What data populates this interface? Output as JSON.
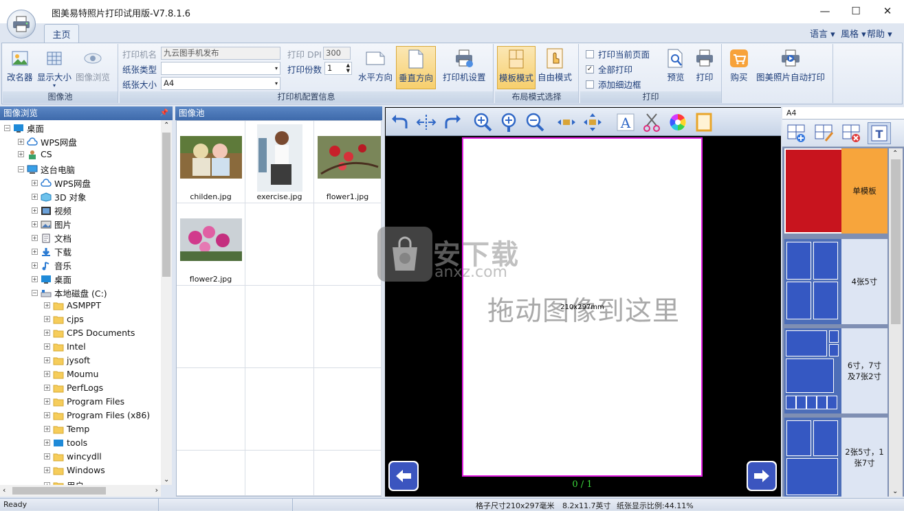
{
  "app": {
    "title": "图美易特照片打印试用版-V7.8.1.6",
    "tab_main": "主页"
  },
  "menu": {
    "language": "语言",
    "style": "風格",
    "help": "帮助"
  },
  "ribbon": {
    "image_pool_group": {
      "caption": "图像池",
      "rename": "改名器",
      "display_size": "显示大小",
      "image_browse": "图像浏览"
    },
    "printer_group": {
      "caption": "打印机配置信息",
      "printer_name_label": "打印机名",
      "printer_name_value": "九云图手机发布",
      "paper_type_label": "纸张类型",
      "paper_type_value": "",
      "paper_size_label": "纸张大小",
      "paper_size_value": "A4",
      "dpi_label": "打印 DPI",
      "dpi_value": "300",
      "copies_label": "打印份数",
      "copies_value": "1",
      "horizontal": "水平方向",
      "vertical": "垂直方向",
      "printer_settings": "打印机设置"
    },
    "layout_group": {
      "caption": "布局模式选择",
      "template_mode": "模板模式",
      "free_mode": "自由模式"
    },
    "print_group": {
      "caption": "打印",
      "print_current": "打印当前页面",
      "print_all": "全部打印",
      "add_border": "添加细边框",
      "preview": "预览",
      "print": "打印"
    },
    "buy_group": {
      "buy": "购买",
      "auto_print": "图美照片自动打印"
    }
  },
  "browser": {
    "title": "图像浏览",
    "items": [
      {
        "label": "桌面",
        "level": 0,
        "icon": "desktop-icon",
        "sign": "−"
      },
      {
        "label": "WPS网盘",
        "level": 1,
        "icon": "cloud-icon",
        "sign": "+"
      },
      {
        "label": "CS",
        "level": 1,
        "icon": "user-icon",
        "sign": "+"
      },
      {
        "label": "这台电脑",
        "level": 1,
        "icon": "computer-icon",
        "sign": "−"
      },
      {
        "label": "WPS网盘",
        "level": 2,
        "icon": "cloud-icon",
        "sign": "+"
      },
      {
        "label": "3D 对象",
        "level": 2,
        "icon": "cube-icon",
        "sign": "+"
      },
      {
        "label": "视频",
        "level": 2,
        "icon": "video-icon",
        "sign": "+"
      },
      {
        "label": "图片",
        "level": 2,
        "icon": "picture-icon",
        "sign": "+"
      },
      {
        "label": "文档",
        "level": 2,
        "icon": "document-icon",
        "sign": "+"
      },
      {
        "label": "下载",
        "level": 2,
        "icon": "download-icon",
        "sign": "+"
      },
      {
        "label": "音乐",
        "level": 2,
        "icon": "music-icon",
        "sign": "+"
      },
      {
        "label": "桌面",
        "level": 2,
        "icon": "desktop-icon",
        "sign": "+"
      },
      {
        "label": "本地磁盘 (C:)",
        "level": 2,
        "icon": "drive-icon",
        "sign": "−"
      },
      {
        "label": "ASMPPT",
        "level": 3,
        "icon": "folder-icon",
        "sign": "+"
      },
      {
        "label": "cjps",
        "level": 3,
        "icon": "folder-icon",
        "sign": "+"
      },
      {
        "label": "CPS Documents",
        "level": 3,
        "icon": "folder-icon",
        "sign": "+"
      },
      {
        "label": "Intel",
        "level": 3,
        "icon": "folder-icon",
        "sign": "+"
      },
      {
        "label": "jysoft",
        "level": 3,
        "icon": "folder-icon",
        "sign": "+"
      },
      {
        "label": "Moumu",
        "level": 3,
        "icon": "folder-icon",
        "sign": "+"
      },
      {
        "label": "PerfLogs",
        "level": 3,
        "icon": "folder-icon",
        "sign": "+"
      },
      {
        "label": "Program Files",
        "level": 3,
        "icon": "folder-icon",
        "sign": "+"
      },
      {
        "label": "Program Files (x86)",
        "level": 3,
        "icon": "folder-icon",
        "sign": "+"
      },
      {
        "label": "Temp",
        "level": 3,
        "icon": "folder-icon",
        "sign": "+"
      },
      {
        "label": "tools",
        "level": 3,
        "icon": "folder-blue-icon",
        "sign": "+"
      },
      {
        "label": "wincydll",
        "level": 3,
        "icon": "folder-icon",
        "sign": "+"
      },
      {
        "label": "Windows",
        "level": 3,
        "icon": "folder-icon",
        "sign": "+"
      },
      {
        "label": "用户",
        "level": 3,
        "icon": "folder-icon",
        "sign": "+"
      }
    ]
  },
  "pool": {
    "title": "图像池",
    "images": [
      {
        "name": "childen.jpg"
      },
      {
        "name": "exercise.jpg"
      },
      {
        "name": "flower1.jpg"
      },
      {
        "name": "flower2.jpg"
      }
    ]
  },
  "preview": {
    "hint": "拖动图像到这里",
    "size_label": "210x297mm",
    "page_counter": "0 / 1",
    "watermark_cn": "安下载",
    "watermark_en": "anxz.com"
  },
  "templates": {
    "paper": "A4",
    "items": [
      {
        "label": "单模板"
      },
      {
        "label": "4张5寸"
      },
      {
        "label": "6寸，7寸及7张2寸"
      },
      {
        "label": "2张5寸，1张7寸"
      }
    ]
  },
  "status": {
    "ready": "Ready",
    "cell_size": "格子尺寸210x297毫米",
    "inches": "8.2x11.7英寸",
    "scale": "纸张显示比例:44.11%"
  },
  "colors": {
    "accent_blue": "#3e6aab",
    "template_red": "#c8141e",
    "template_orange": "#f7a53c",
    "page_border": "#e31ee3"
  }
}
